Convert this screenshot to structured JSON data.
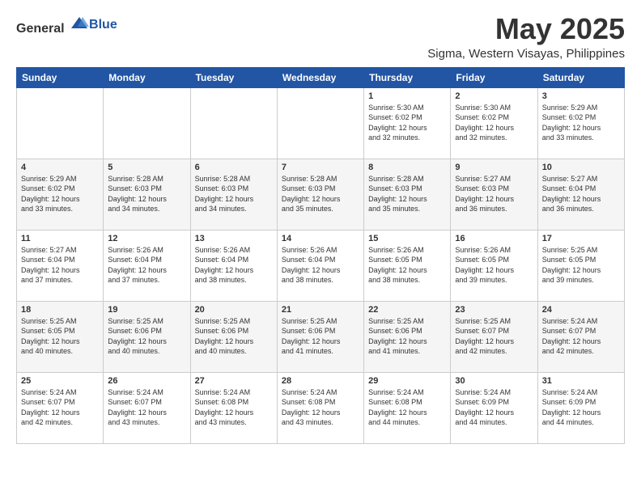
{
  "header": {
    "logo_general": "General",
    "logo_blue": "Blue",
    "month_title": "May 2025",
    "location": "Sigma, Western Visayas, Philippines"
  },
  "calendar": {
    "days_of_week": [
      "Sunday",
      "Monday",
      "Tuesday",
      "Wednesday",
      "Thursday",
      "Friday",
      "Saturday"
    ],
    "weeks": [
      [
        {
          "day": "",
          "info": ""
        },
        {
          "day": "",
          "info": ""
        },
        {
          "day": "",
          "info": ""
        },
        {
          "day": "",
          "info": ""
        },
        {
          "day": "1",
          "info": "Sunrise: 5:30 AM\nSunset: 6:02 PM\nDaylight: 12 hours\nand 32 minutes."
        },
        {
          "day": "2",
          "info": "Sunrise: 5:30 AM\nSunset: 6:02 PM\nDaylight: 12 hours\nand 32 minutes."
        },
        {
          "day": "3",
          "info": "Sunrise: 5:29 AM\nSunset: 6:02 PM\nDaylight: 12 hours\nand 33 minutes."
        }
      ],
      [
        {
          "day": "4",
          "info": "Sunrise: 5:29 AM\nSunset: 6:02 PM\nDaylight: 12 hours\nand 33 minutes."
        },
        {
          "day": "5",
          "info": "Sunrise: 5:28 AM\nSunset: 6:03 PM\nDaylight: 12 hours\nand 34 minutes."
        },
        {
          "day": "6",
          "info": "Sunrise: 5:28 AM\nSunset: 6:03 PM\nDaylight: 12 hours\nand 34 minutes."
        },
        {
          "day": "7",
          "info": "Sunrise: 5:28 AM\nSunset: 6:03 PM\nDaylight: 12 hours\nand 35 minutes."
        },
        {
          "day": "8",
          "info": "Sunrise: 5:28 AM\nSunset: 6:03 PM\nDaylight: 12 hours\nand 35 minutes."
        },
        {
          "day": "9",
          "info": "Sunrise: 5:27 AM\nSunset: 6:03 PM\nDaylight: 12 hours\nand 36 minutes."
        },
        {
          "day": "10",
          "info": "Sunrise: 5:27 AM\nSunset: 6:04 PM\nDaylight: 12 hours\nand 36 minutes."
        }
      ],
      [
        {
          "day": "11",
          "info": "Sunrise: 5:27 AM\nSunset: 6:04 PM\nDaylight: 12 hours\nand 37 minutes."
        },
        {
          "day": "12",
          "info": "Sunrise: 5:26 AM\nSunset: 6:04 PM\nDaylight: 12 hours\nand 37 minutes."
        },
        {
          "day": "13",
          "info": "Sunrise: 5:26 AM\nSunset: 6:04 PM\nDaylight: 12 hours\nand 38 minutes."
        },
        {
          "day": "14",
          "info": "Sunrise: 5:26 AM\nSunset: 6:04 PM\nDaylight: 12 hours\nand 38 minutes."
        },
        {
          "day": "15",
          "info": "Sunrise: 5:26 AM\nSunset: 6:05 PM\nDaylight: 12 hours\nand 38 minutes."
        },
        {
          "day": "16",
          "info": "Sunrise: 5:26 AM\nSunset: 6:05 PM\nDaylight: 12 hours\nand 39 minutes."
        },
        {
          "day": "17",
          "info": "Sunrise: 5:25 AM\nSunset: 6:05 PM\nDaylight: 12 hours\nand 39 minutes."
        }
      ],
      [
        {
          "day": "18",
          "info": "Sunrise: 5:25 AM\nSunset: 6:05 PM\nDaylight: 12 hours\nand 40 minutes."
        },
        {
          "day": "19",
          "info": "Sunrise: 5:25 AM\nSunset: 6:06 PM\nDaylight: 12 hours\nand 40 minutes."
        },
        {
          "day": "20",
          "info": "Sunrise: 5:25 AM\nSunset: 6:06 PM\nDaylight: 12 hours\nand 40 minutes."
        },
        {
          "day": "21",
          "info": "Sunrise: 5:25 AM\nSunset: 6:06 PM\nDaylight: 12 hours\nand 41 minutes."
        },
        {
          "day": "22",
          "info": "Sunrise: 5:25 AM\nSunset: 6:06 PM\nDaylight: 12 hours\nand 41 minutes."
        },
        {
          "day": "23",
          "info": "Sunrise: 5:25 AM\nSunset: 6:07 PM\nDaylight: 12 hours\nand 42 minutes."
        },
        {
          "day": "24",
          "info": "Sunrise: 5:24 AM\nSunset: 6:07 PM\nDaylight: 12 hours\nand 42 minutes."
        }
      ],
      [
        {
          "day": "25",
          "info": "Sunrise: 5:24 AM\nSunset: 6:07 PM\nDaylight: 12 hours\nand 42 minutes."
        },
        {
          "day": "26",
          "info": "Sunrise: 5:24 AM\nSunset: 6:07 PM\nDaylight: 12 hours\nand 43 minutes."
        },
        {
          "day": "27",
          "info": "Sunrise: 5:24 AM\nSunset: 6:08 PM\nDaylight: 12 hours\nand 43 minutes."
        },
        {
          "day": "28",
          "info": "Sunrise: 5:24 AM\nSunset: 6:08 PM\nDaylight: 12 hours\nand 43 minutes."
        },
        {
          "day": "29",
          "info": "Sunrise: 5:24 AM\nSunset: 6:08 PM\nDaylight: 12 hours\nand 44 minutes."
        },
        {
          "day": "30",
          "info": "Sunrise: 5:24 AM\nSunset: 6:09 PM\nDaylight: 12 hours\nand 44 minutes."
        },
        {
          "day": "31",
          "info": "Sunrise: 5:24 AM\nSunset: 6:09 PM\nDaylight: 12 hours\nand 44 minutes."
        }
      ]
    ]
  }
}
